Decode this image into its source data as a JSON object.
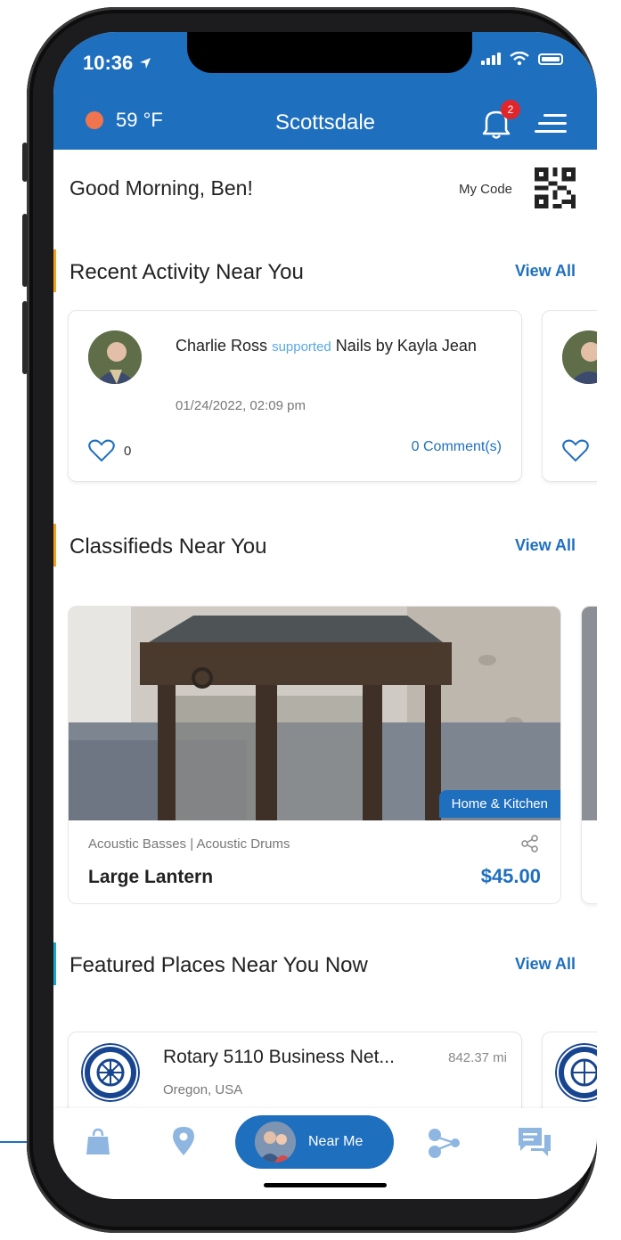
{
  "status_bar": {
    "time": "10:36"
  },
  "header": {
    "temperature": "59 °F",
    "city": "Scottsdale",
    "notification_count": "2"
  },
  "greeting": "Good Morning, Ben!",
  "my_code_label": "My Code",
  "recent_activity": {
    "title": "Recent Activity Near You",
    "view_all": "View All",
    "items": [
      {
        "user": "Charlie Ross",
        "action": "supported",
        "target": "Nails by Kayla Jean",
        "date": "01/24/2022, 02:09 pm",
        "likes": "0",
        "comments": "0 Comment(s)"
      }
    ]
  },
  "classifieds": {
    "title": "Classifieds Near You",
    "view_all": "View All",
    "items": [
      {
        "category_tag": "Home & Kitchen",
        "subcategories": "Acoustic Basses | Acoustic Drums",
        "name": "Large Lantern",
        "price": "$45.00"
      }
    ]
  },
  "featured_places": {
    "title": "Featured Places Near You Now",
    "view_all": "View All",
    "items": [
      {
        "name": "Rotary 5110 Business Net...",
        "distance": "842.37 mi",
        "location": "Oregon, USA"
      }
    ]
  },
  "bottom_nav": {
    "items": [
      "bag-icon",
      "location-pin-icon",
      "near-me-button",
      "connections-icon",
      "chat-icon"
    ],
    "near_me_label": "Near Me"
  },
  "colors": {
    "primary": "#1f6fbf",
    "accent_bar": "#f2a11b",
    "weather_dot": "#f0744e",
    "badge": "#e0262b"
  }
}
